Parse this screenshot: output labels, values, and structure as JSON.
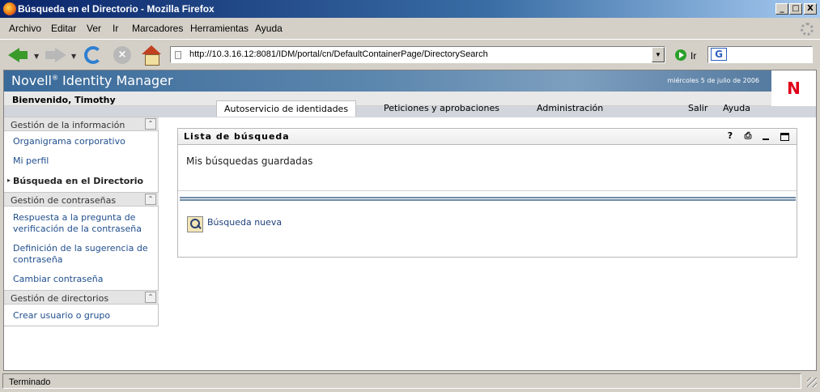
{
  "window": {
    "title": "Búsqueda en el Directorio - Mozilla Firefox",
    "minimize_glyph": "_",
    "maximize_glyph": "□",
    "close_glyph": "X"
  },
  "menu": [
    "Archivo",
    "Editar",
    "Ver",
    "Ir",
    "Marcadores",
    "Herramientas",
    "Ayuda"
  ],
  "toolbar": {
    "url": "http://10.3.16.12:8081/IDM/portal/cn/DefaultContainerPage/DirectorySearch",
    "go_label": "Ir",
    "dropdown_glyph": "▼",
    "stop_glyph": "×",
    "search_engine_glyph": "G"
  },
  "app": {
    "brand": "Novell",
    "brand_mark": "®",
    "brand_product": " Identity Manager",
    "date": "miércoles 5 de julio de 2006",
    "logo": "N",
    "welcome": "Bienvenido, Timothy"
  },
  "tabs": [
    {
      "label": "Autoservicio de identidades",
      "active": true
    },
    {
      "label": "Peticiones y aprobaciones",
      "active": false
    },
    {
      "label": "Administración",
      "active": false
    }
  ],
  "header_links": {
    "logout": "Salir",
    "help": "Ayuda"
  },
  "sidebar": {
    "collapse_glyph": "⌃",
    "bullet": "▸",
    "sections": [
      {
        "label": "Gestión de la información",
        "items": [
          "Organigrama corporativo",
          "Mi perfil",
          "Búsqueda en el Directorio"
        ]
      },
      {
        "label": "Gestión de contraseñas",
        "items": [
          "Respuesta a la pregunta de verificación de la contraseña",
          "Definición de la sugerencia de contraseña",
          "Cambiar contraseña"
        ]
      },
      {
        "label": "Gestión de directorios",
        "items": [
          "Crear usuario o grupo"
        ]
      }
    ]
  },
  "portlet": {
    "title": "Lista de búsqueda",
    "help_glyph": "?",
    "print_glyph": "⎙",
    "saved_label": "Mis búsquedas guardadas",
    "new_search": "Búsqueda nueva"
  },
  "status": {
    "text": "Terminado"
  }
}
